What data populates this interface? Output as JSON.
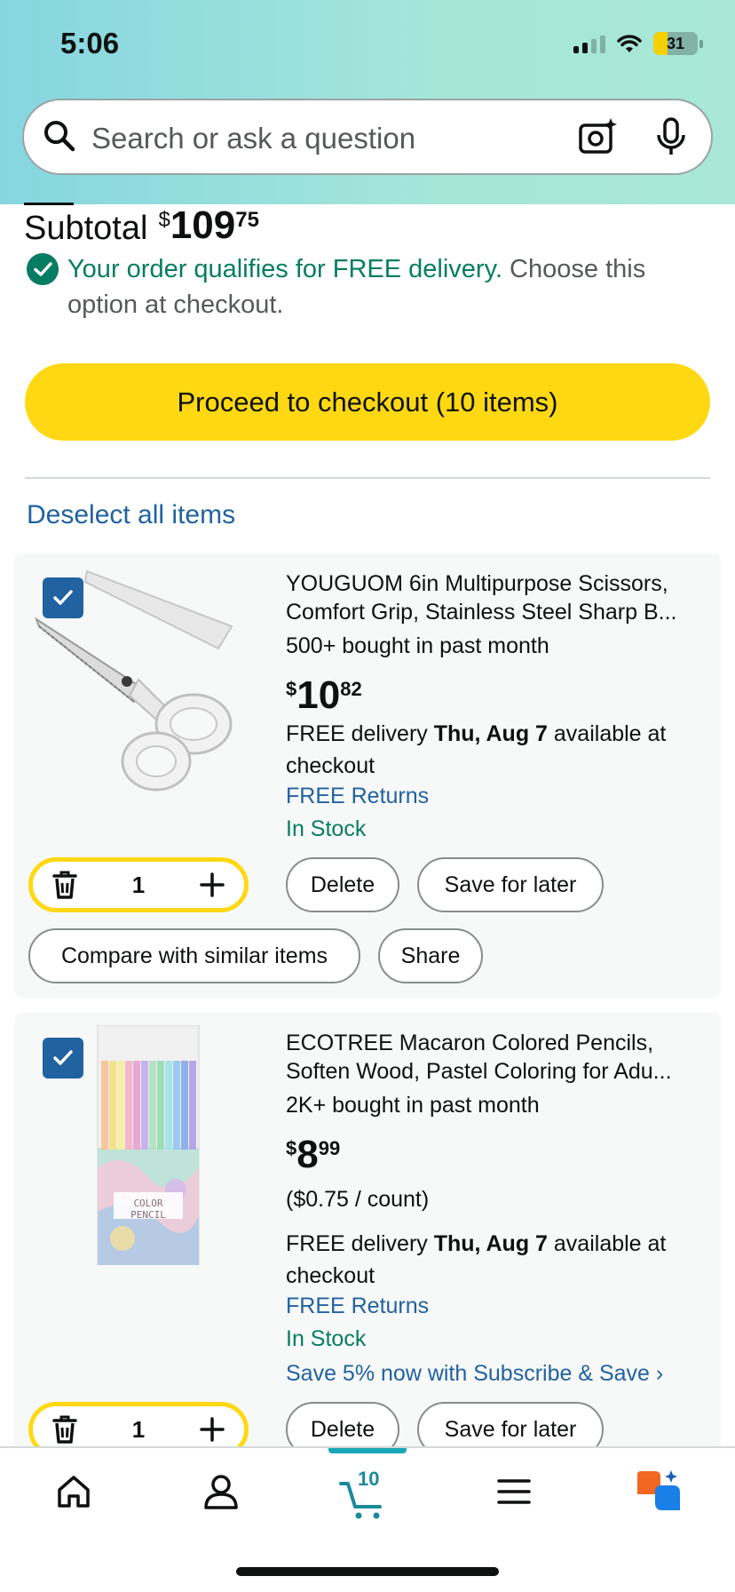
{
  "status_bar": {
    "time": "5:06",
    "battery": "31",
    "battery_level": 0.31
  },
  "search": {
    "placeholder": "Search or ask a question"
  },
  "subtotal": {
    "label": "Subtotal",
    "currency": "$",
    "whole": "109",
    "fraction": "75"
  },
  "free_delivery": {
    "qualifies": "Your order qualifies for FREE delivery.",
    "note": " Choose this option at checkout."
  },
  "checkout": {
    "label": "Proceed to checkout (10 items)"
  },
  "deselect": {
    "label": "Deselect all items"
  },
  "items": [
    {
      "title_line1": "YOUGUOM 6in Multipurpose Scissors,",
      "title_line2": "Comfort Grip, Stainless Steel Sharp B...",
      "bought": "500+ bought in past month",
      "price_symbol": "$",
      "price_whole": "10",
      "price_fraction": "82",
      "delivery_prefix": "FREE delivery ",
      "delivery_date": "Thu, Aug 7",
      "delivery_suffix": " available at checkout",
      "returns": "FREE Returns",
      "stock": "In Stock",
      "quantity": "1",
      "delete_label": "Delete",
      "save_label": "Save for later",
      "compare_label": "Compare with similar items",
      "share_label": "Share"
    },
    {
      "title_line1": "ECOTREE Macaron Colored Pencils,",
      "title_line2": "Soften Wood, Pastel Coloring for Adu...",
      "bought": "2K+ bought in past month",
      "price_symbol": "$",
      "price_whole": "8",
      "price_fraction": "99",
      "unit_price": "($0.75 / count)",
      "delivery_prefix": "FREE delivery ",
      "delivery_date": "Thu, Aug 7",
      "delivery_suffix": " available at checkout",
      "returns": "FREE Returns",
      "stock": "In Stock",
      "subscribe": "Save 5% now with Subscribe & Save ›",
      "image_text": "COLOR PENCIL",
      "quantity": "1",
      "delete_label": "Delete",
      "save_label": "Save for later"
    }
  ],
  "nav": {
    "cart_count": "10"
  },
  "colors": {
    "accent_yellow": "#ffd814",
    "link_blue": "#2162a1",
    "success_green": "#067d62",
    "teal": "#1aa6b7"
  }
}
